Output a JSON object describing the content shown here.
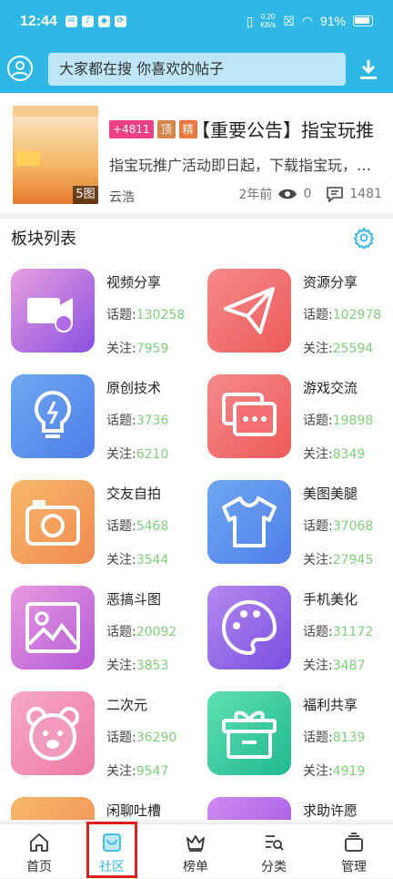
{
  "status": {
    "time": "12:44",
    "net_speed": "0.20",
    "net_unit": "KB/s",
    "battery": "91%"
  },
  "search": {
    "placeholder": "大家都在搜  你喜欢的帖子"
  },
  "notice": {
    "count_tag": "+4811",
    "top_tag": "顶",
    "essence_tag": "精",
    "title": "【重要公告】指宝玩推",
    "summary": "指宝玩推广活动即日起，下载指宝玩，…",
    "author": "云浩",
    "time_ago": "2年前",
    "views": "0",
    "comments": "1481",
    "image_count": "5图"
  },
  "section": {
    "title": "板块列表"
  },
  "boards": [
    {
      "name": "视频分享",
      "topics_label": "话题:",
      "topics": "130258",
      "follow_label": "关注:",
      "follow": "7959",
      "icon": "video-icon",
      "gradient": [
        "#e8a0e0",
        "#8a4fe0"
      ]
    },
    {
      "name": "资源分享",
      "topics_label": "话题:",
      "topics": "102978",
      "follow_label": "关注:",
      "follow": "25594",
      "icon": "paper-plane-icon",
      "gradient": [
        "#f58a8a",
        "#ee5a5a"
      ]
    },
    {
      "name": "原创技术",
      "topics_label": "话题:",
      "topics": "3736",
      "follow_label": "关注:",
      "follow": "6210",
      "icon": "lightbulb-icon",
      "gradient": [
        "#6fa8f2",
        "#4f7ee8"
      ]
    },
    {
      "name": "游戏交流",
      "topics_label": "话题:",
      "topics": "19898",
      "follow_label": "关注:",
      "follow": "8349",
      "icon": "chat-icon",
      "gradient": [
        "#f58a8a",
        "#ee5a5a"
      ]
    },
    {
      "name": "交友自拍",
      "topics_label": "话题:",
      "topics": "5468",
      "follow_label": "关注:",
      "follow": "3544",
      "icon": "camera-icon",
      "gradient": [
        "#f8b86a",
        "#f08a50"
      ]
    },
    {
      "name": "美图美腿",
      "topics_label": "话题:",
      "topics": "37068",
      "follow_label": "关注:",
      "follow": "27945",
      "icon": "shirt-icon",
      "gradient": [
        "#6fa8f2",
        "#4f7ee8"
      ]
    },
    {
      "name": "恶搞斗图",
      "topics_label": "话题:",
      "topics": "20092",
      "follow_label": "关注:",
      "follow": "3853",
      "icon": "image-icon",
      "gradient": [
        "#e89ae0",
        "#b45ad8"
      ]
    },
    {
      "name": "手机美化",
      "topics_label": "话题:",
      "topics": "31172",
      "follow_label": "关注:",
      "follow": "3487",
      "icon": "palette-icon",
      "gradient": [
        "#b58af0",
        "#7a4fe0"
      ]
    },
    {
      "name": "二次元",
      "topics_label": "话题:",
      "topics": "36290",
      "follow_label": "关注:",
      "follow": "9547",
      "icon": "bear-icon",
      "gradient": [
        "#f7a8c8",
        "#ee7aa6"
      ]
    },
    {
      "name": "福利共享",
      "topics_label": "话题:",
      "topics": "8139",
      "follow_label": "关注:",
      "follow": "4919",
      "icon": "gift-icon",
      "gradient": [
        "#5fe0b0",
        "#20b890"
      ]
    },
    {
      "name": "闲聊吐槽",
      "icon": "wave-icon",
      "gradient": [
        "#f8b86a",
        "#f08a50"
      ]
    },
    {
      "name": "求助许愿",
      "icon": "star-icon",
      "gradient": [
        "#d08af0",
        "#9a4fe0"
      ]
    }
  ],
  "tabs": [
    {
      "label": "首页",
      "icon": "home-icon"
    },
    {
      "label": "社区",
      "icon": "community-icon"
    },
    {
      "label": "榜单",
      "icon": "crown-icon"
    },
    {
      "label": "分类",
      "icon": "category-search-icon"
    },
    {
      "label": "管理",
      "icon": "manage-icon"
    }
  ],
  "colors": {
    "accent": "#2fb8e6",
    "value_green": "#7fcf7a",
    "highlight_red": "#e01e1e"
  }
}
